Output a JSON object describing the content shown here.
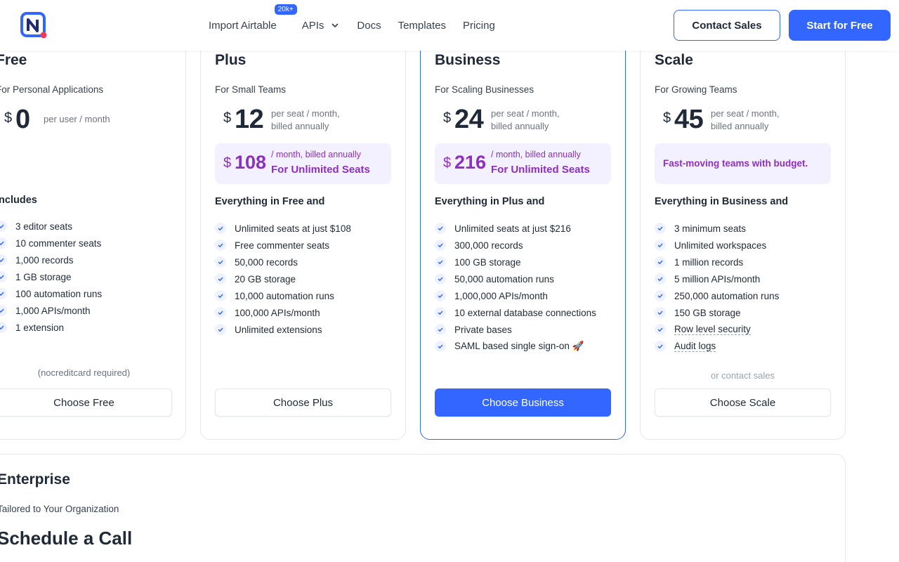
{
  "header": {
    "nav": [
      {
        "label": "Import Airtable",
        "badge": "20k+"
      },
      {
        "label": "APIs"
      },
      {
        "label": "Docs"
      },
      {
        "label": "Templates"
      },
      {
        "label": "Pricing"
      }
    ],
    "contact_sales": "Contact Sales",
    "start_free": "Start for Free"
  },
  "plans": [
    {
      "name": "Free",
      "subtitle": "For Personal Applications",
      "currency": "$",
      "price": "0",
      "per": "per user / month",
      "features_head": "Includes",
      "features": [
        "3 editor seats",
        "10 commenter seats",
        "1,000 records",
        "1 GB storage",
        "100 automation runs",
        "1,000 APIs/month",
        "1 extension"
      ],
      "note": "(nocreditcard required)",
      "cta": "Choose Free"
    },
    {
      "name": "Plus",
      "subtitle": "For Small Teams",
      "currency": "$",
      "price": "12",
      "per": "per seat / month,",
      "per2": "billed annually",
      "unlimited_currency": "$",
      "unlimited_price": "108",
      "unlimited_per": "/ month, billed annually",
      "unlimited_label": "For Unlimited Seats",
      "features_head": "Everything in Free and",
      "features": [
        "Unlimited seats at just $108",
        "Free commenter seats",
        "50,000 records",
        "20 GB storage",
        "10,000 automation runs",
        "100,000 APIs/month",
        "Unlimited extensions"
      ],
      "cta": "Choose Plus"
    },
    {
      "name": "Business",
      "subtitle": "For Scaling Businesses",
      "currency": "$",
      "price": "24",
      "per": "per seat / month,",
      "per2": "billed annually",
      "unlimited_currency": "$",
      "unlimited_price": "216",
      "unlimited_per": "/ month, billed annually",
      "unlimited_label": "For Unlimited Seats",
      "features_head": "Everything in Plus and",
      "features": [
        "Unlimited seats at just $216",
        "300,000 records",
        "100 GB storage",
        "50,000 automation runs",
        "1,000,000 APIs/month",
        "10 external database connections",
        "Private bases",
        "SAML based single sign-on 🚀"
      ],
      "cta": "Choose Business"
    },
    {
      "name": "Scale",
      "subtitle": "For Growing Teams",
      "currency": "$",
      "price": "45",
      "per": "per seat / month,",
      "per2": "billed annually",
      "highlight_note": "Fast-moving teams with budget.",
      "features_head": "Everything in Business and",
      "features": [
        "3 minimum seats",
        "Unlimited workspaces",
        "1 million records",
        "5 million APIs/month",
        "250,000 automation runs",
        "150 GB storage",
        "Row level security",
        "Audit logs"
      ],
      "note": "or contact sales",
      "cta": "Choose Scale"
    }
  ],
  "enterprise": {
    "name": "Enterprise",
    "subtitle": "Tailored to Your Organization",
    "cta_title": "Schedule a Call"
  },
  "colors": {
    "accent": "#3366ff",
    "purple": "#8e2fc0",
    "lavender": "#f3f0ff"
  }
}
